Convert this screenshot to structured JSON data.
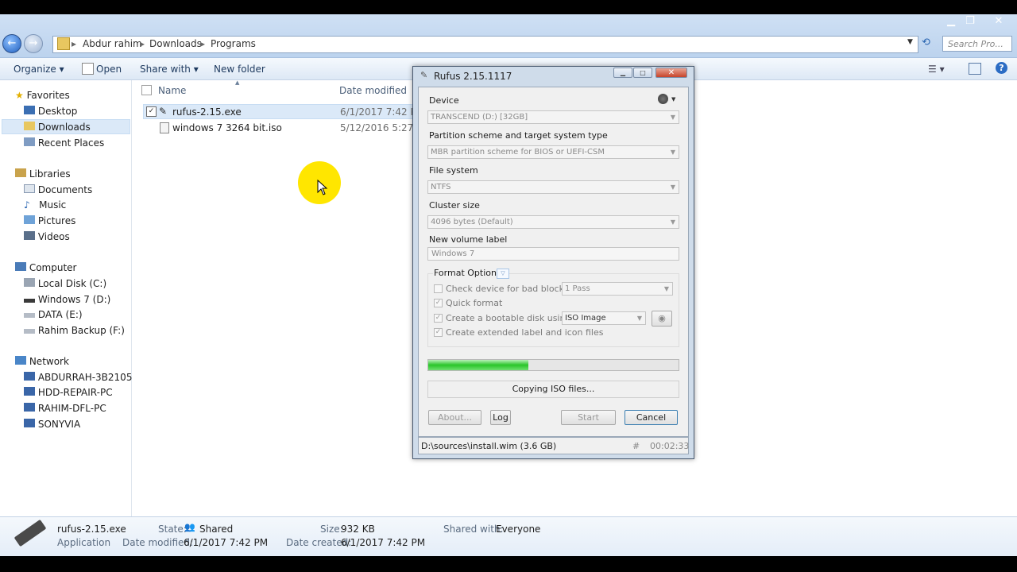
{
  "explorer": {
    "breadcrumb": [
      "Abdur rahim",
      "Downloads",
      "Programs"
    ],
    "search_placeholder": "Search Pro...",
    "toolbar": {
      "organize": "Organize",
      "open": "Open",
      "share_with": "Share with",
      "new_folder": "New folder"
    },
    "columns": {
      "name": "Name",
      "date_modified": "Date modified"
    },
    "files": [
      {
        "name": "rufus-2.15.exe",
        "date": "6/1/2017 7:42 PM",
        "checked": true
      },
      {
        "name": "windows 7 3264 bit.iso",
        "date": "5/12/2016 5:27 PM",
        "checked": false
      }
    ],
    "nav": {
      "favorites": "Favorites",
      "desktop": "Desktop",
      "downloads": "Downloads",
      "recent": "Recent Places",
      "libraries": "Libraries",
      "documents": "Documents",
      "music": "Music",
      "pictures": "Pictures",
      "videos": "Videos",
      "computer": "Computer",
      "local_disk": "Local Disk (C:)",
      "win7": "Windows 7 (D:)",
      "data": "DATA (E:)",
      "backup": "Rahim Backup (F:)",
      "network": "Network",
      "net1": "ABDURRAH-3B2105",
      "net2": "HDD-REPAIR-PC",
      "net3": "RAHIM-DFL-PC",
      "net4": "SONYVIA"
    },
    "details": {
      "filename": "rufus-2.15.exe",
      "type": "Application",
      "state_label": "State:",
      "state_value": "Shared",
      "date_mod_label": "Date modified:",
      "date_mod_value": "6/1/2017 7:42 PM",
      "size_label": "Size:",
      "size_value": "932 KB",
      "date_created_label": "Date created:",
      "date_created_value": "6/1/2017 7:42 PM",
      "shared_label": "Shared with:",
      "shared_value": "Everyone"
    }
  },
  "rufus": {
    "title": "Rufus 2.15.1117",
    "device_label": "Device",
    "device_value": "TRANSCEND (D:) [32GB]",
    "partition_label": "Partition scheme and target system type",
    "partition_value": "MBR partition scheme for BIOS or UEFI-CSM",
    "fs_label": "File system",
    "fs_value": "NTFS",
    "cluster_label": "Cluster size",
    "cluster_value": "4096 bytes (Default)",
    "volume_label": "New volume label",
    "volume_value": "Windows 7",
    "format_options": "Format Options",
    "check_bad": "Check device for bad blocks",
    "passes": "1 Pass",
    "quick_format": "Quick format",
    "bootable": "Create a bootable disk using",
    "boot_type": "ISO Image",
    "extended": "Create extended label and icon files",
    "progress": 0.4,
    "status_text": "Copying ISO files...",
    "btn_about": "About...",
    "btn_log": "Log",
    "btn_start": "Start",
    "btn_cancel": "Cancel",
    "footer_file": "D:\\sources\\install.wim (3.6 GB)",
    "footer_hash": "#",
    "footer_time": "00:02:33"
  }
}
